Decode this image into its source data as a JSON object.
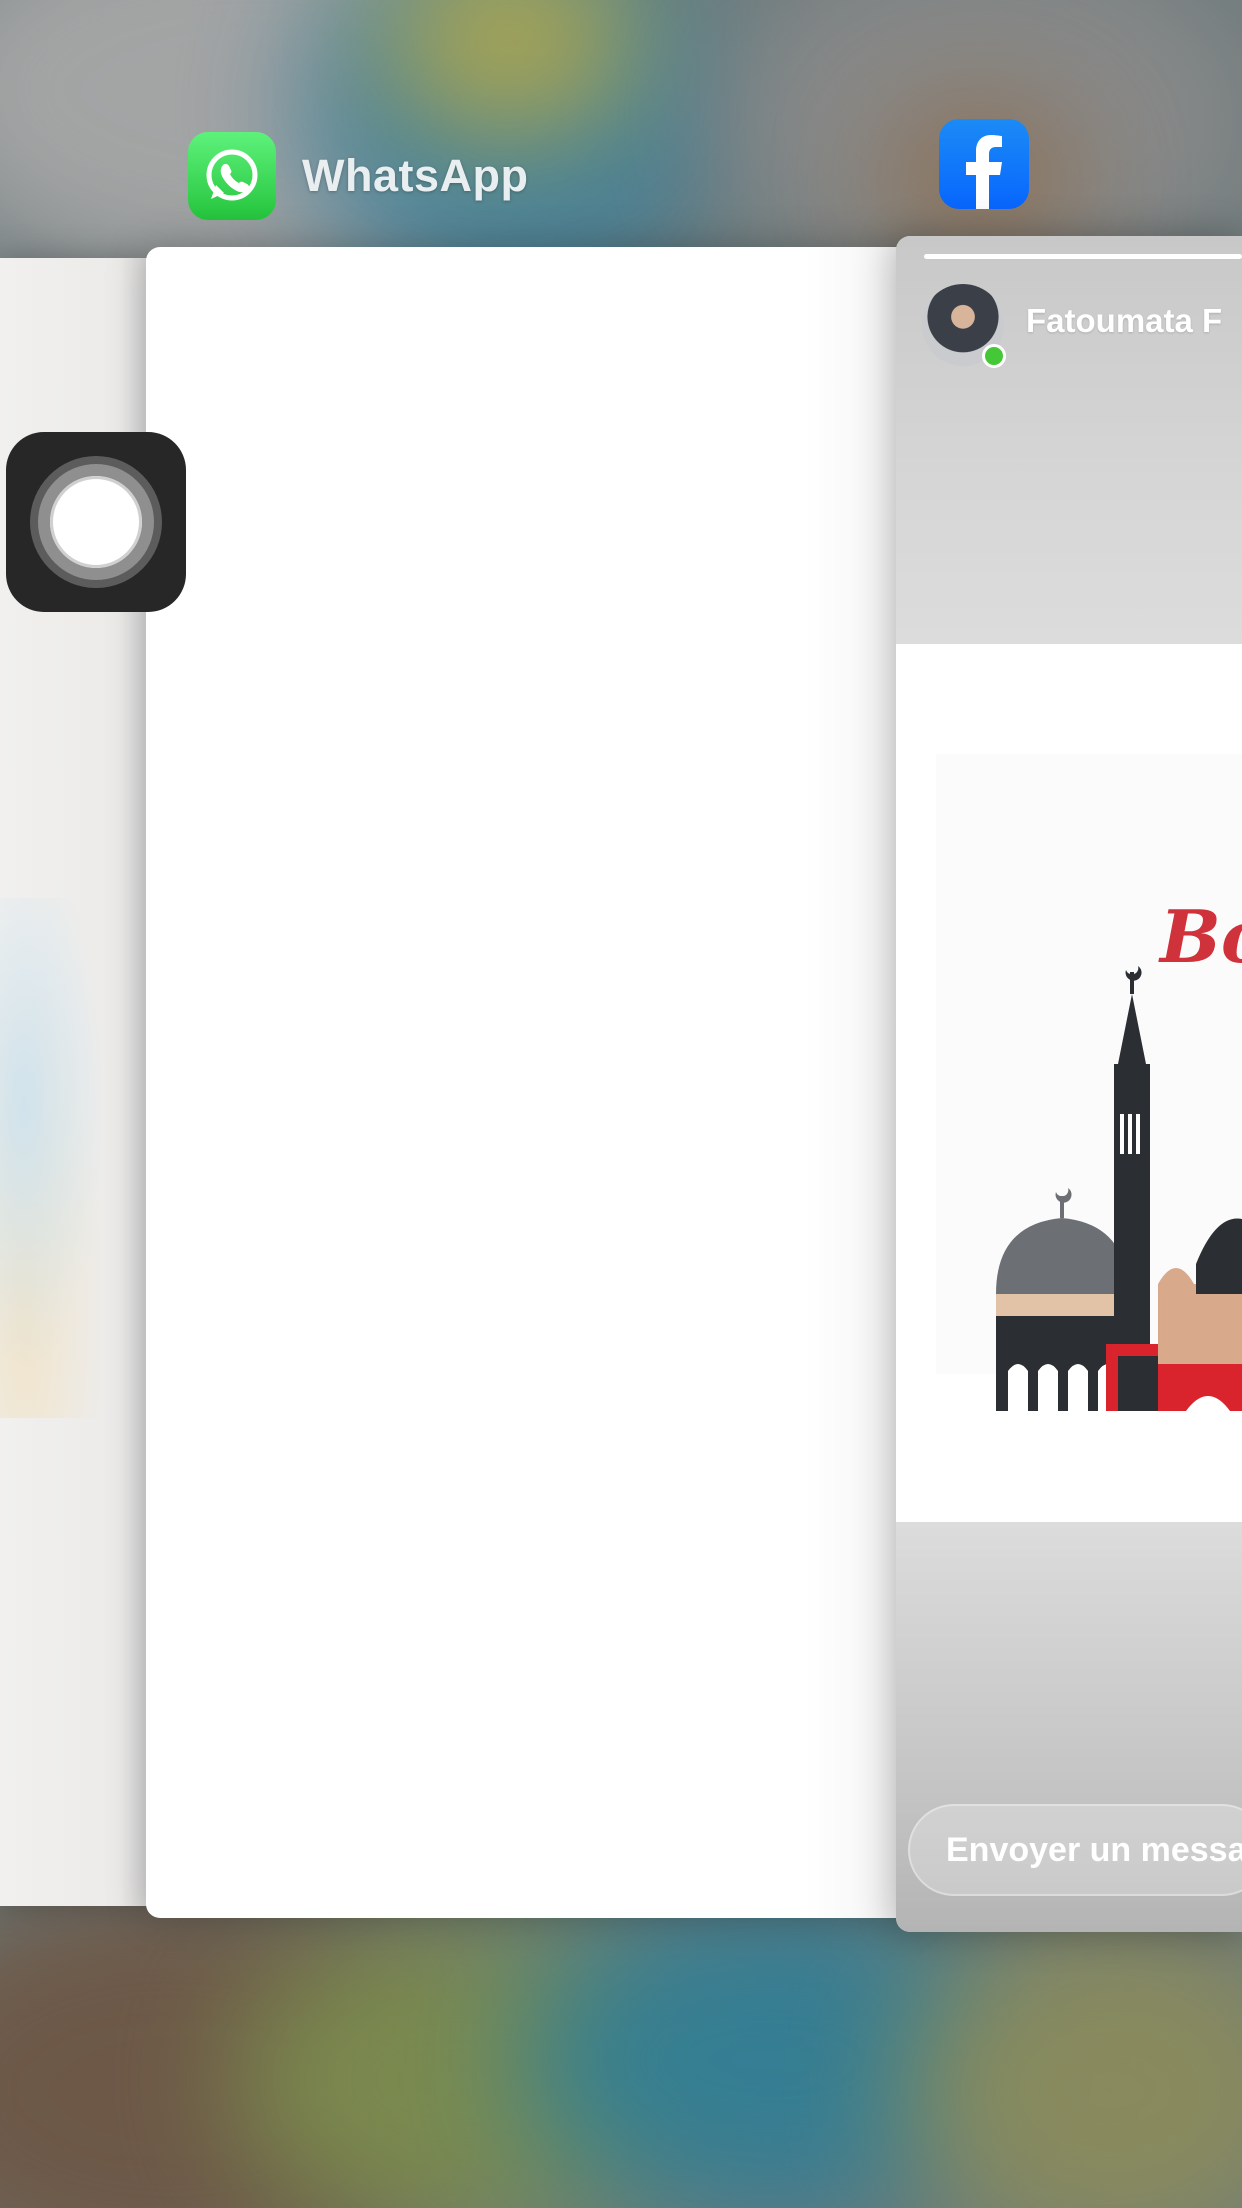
{
  "app_switcher": {
    "whatsapp": {
      "name": "WhatsApp",
      "icon": "whatsapp-icon",
      "accent": "#25C43D"
    },
    "facebook": {
      "icon": "facebook-icon",
      "accent": "#0866FF",
      "story": {
        "author": "Fatoumata F",
        "post_text": "Bon",
        "reply_placeholder": "Envoyer un messa"
      }
    },
    "assistive_touch": {
      "icon": "assistive-touch-icon"
    }
  }
}
